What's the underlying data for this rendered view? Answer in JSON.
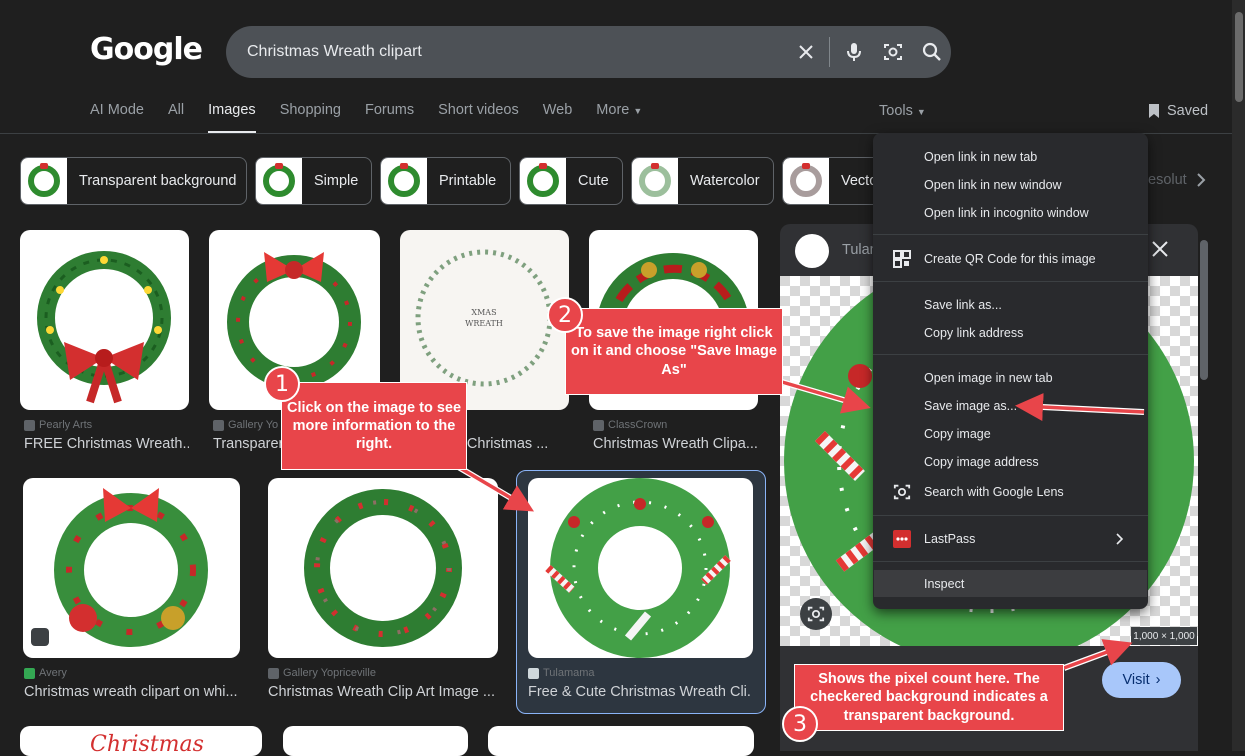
{
  "header": {
    "logo": "Google",
    "search_query": "Christmas Wreath clipart",
    "tabs": [
      "AI Mode",
      "All",
      "Images",
      "Shopping",
      "Forums",
      "Short videos",
      "Web",
      "More"
    ],
    "tools": "Tools",
    "saved": "Saved"
  },
  "chips": [
    "Transparent background",
    "Simple",
    "Printable",
    "Cute",
    "Watercolor",
    "Vecto",
    "esolut"
  ],
  "results": [
    {
      "source": "Pearly Arts",
      "caption": "FREE Christmas Wreath..."
    },
    {
      "source": "Gallery Yo",
      "caption": "Transparen"
    },
    {
      "source": "ock",
      "caption": "or Christmas ..."
    },
    {
      "source": "ClassCrown",
      "caption": "Christmas Wreath Clipa..."
    },
    {
      "source": "Avery",
      "caption": "Christmas wreath clipart on whi..."
    },
    {
      "source": "Gallery Yopriceville",
      "caption": "Christmas Wreath Clip Art Image ..."
    },
    {
      "source": "Tulamama",
      "caption": "Free & Cute Christmas Wreath Cli..."
    }
  ],
  "preview": {
    "source_name": "Tulam",
    "dimensions": "1,000 × 1,000",
    "visit": "Visit"
  },
  "context_menu": {
    "items": [
      "Open link in new tab",
      "Open link in new window",
      "Open link in incognito window",
      "Create QR Code for this image",
      "Save link as...",
      "Copy link address",
      "Open image in new tab",
      "Save image as...",
      "Copy image",
      "Copy image address",
      "Search with Google Lens",
      "LastPass",
      "Inspect"
    ]
  },
  "callouts": [
    {
      "number": "1",
      "text": "Click on the image to see more information to the right."
    },
    {
      "number": "2",
      "text": "To save the image right click on it and choose \"Save Image As\""
    },
    {
      "number": "3",
      "text": "Shows the pixel count here. The checkered background indicates a transparent background."
    }
  ],
  "colors": {
    "callout": "#e8454a",
    "background": "#1f1f1f",
    "accent_button": "#a8c7fa"
  }
}
